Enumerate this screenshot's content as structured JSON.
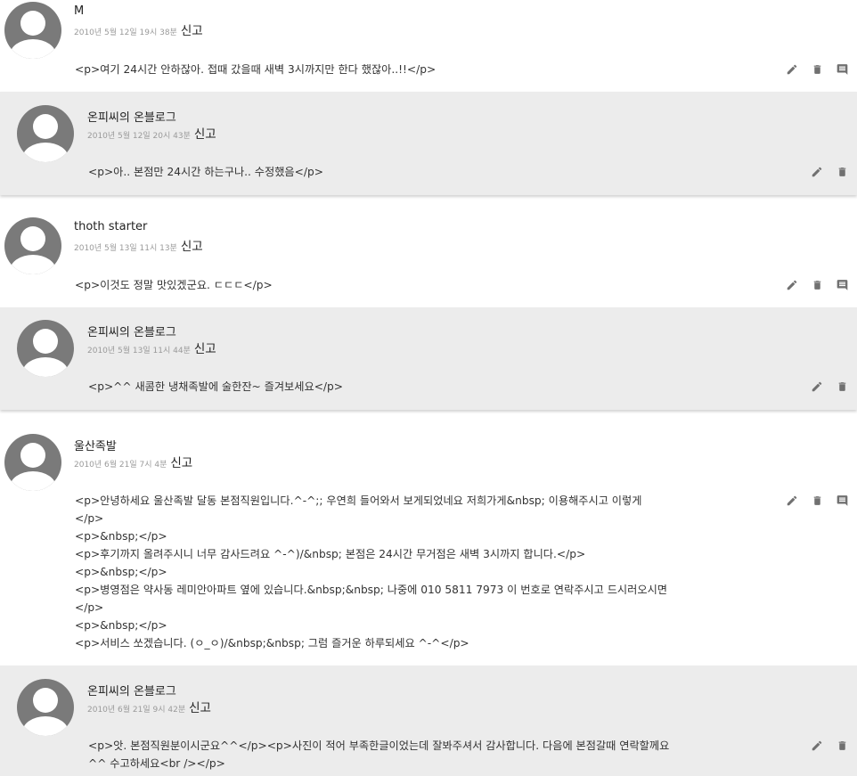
{
  "comments": [
    {
      "author": "M",
      "date": "2010년 5월 12일 19시 38분",
      "report": "신고",
      "text": "<p>여기 24시간 안하잖아. 접때 갔을때 새벽 3시까지만 한다 했잖아..!!</p>",
      "reply": {
        "author": "온피씨의 온블로그",
        "date": "2010년 5월 12일 20시 43분",
        "report": "신고",
        "text": "<p>아.. 본점만 24시간 하는구나.. 수정했음</p>"
      }
    },
    {
      "author": "thoth starter",
      "date": "2010년 5월 13일 11시 13분",
      "report": "신고",
      "text": "<p>이것도 정말 맛있겠군요. ㄷㄷㄷ</p>",
      "reply": {
        "author": "온피씨의 온블로그",
        "date": "2010년 5월 13일 11시 44분",
        "report": "신고",
        "text": "<p>^^ 새콤한 냉채족발에 술한잔~ 즐겨보세요</p>"
      }
    },
    {
      "author": "울산족발",
      "date": "2010년 6월 21일 7시 4분",
      "report": "신고",
      "text": "<p>안녕하세요 울산족발 달동 본점직원입니다.^-^;; 우연희 들어와서 보게되었네요 저희가게&nbsp; 이용해주시고 이렇게\n</p>\n<p>&nbsp;</p>\n<p>후기까지 올려주시니 너무 감사드려요 ^-^)/&nbsp; 본점은 24시간 무거점은 새벽 3시까지 합니다.</p>\n<p>&nbsp;</p>\n<p>병영점은 약사동 레미안아파트 옆에 있습니다.&nbsp;&nbsp; 나중에 010 5811 7973 이 번호로 연락주시고 드시러오시면\n</p>\n<p>&nbsp;</p>\n<p>서비스 쏘겠습니다. (ㅇ_ㅇ)/&nbsp;&nbsp; 그럼 즐거운 하루되세요 ^-^</p>",
      "reply": {
        "author": "온피씨의 온블로그",
        "date": "2010년 6월 21일 9시 42분",
        "report": "신고",
        "text": "<p>앗. 본점직원분이시군요^^</p><p>사진이 적어 부족한글이었는데 잘봐주셔서 감사합니다. 다음에 본점갈때 연락할께요\n^^ 수고하세요<br /></p>"
      }
    }
  ]
}
